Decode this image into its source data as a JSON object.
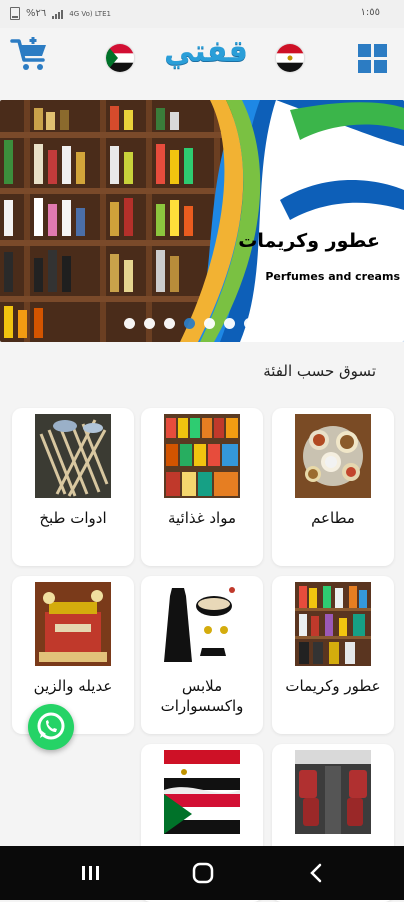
{
  "status_bar": {
    "time": "١:٥٥",
    "battery": "%٢٦",
    "network": "4G Vo) LTE1"
  },
  "header": {
    "logo_text": "قفتي",
    "cart_icon": "cart-icon",
    "menu_icon": "grid-menu-icon"
  },
  "banner": {
    "title": "عطور وكريمات",
    "subtitle": "Perfumes and creams",
    "slide_count": 8,
    "active_slide": 5
  },
  "section": {
    "title": "تسوق حسب الفئة"
  },
  "categories": [
    {
      "label": "مطاعم"
    },
    {
      "label": "مواد غذائية"
    },
    {
      "label": "ادوات طبخ"
    },
    {
      "label": "عطور وكريمات"
    },
    {
      "label": "ملابس واكسسوارات"
    },
    {
      "label": "عديله والزين"
    },
    {
      "label": ""
    },
    {
      "label": ""
    }
  ],
  "colors": {
    "accent": "#2c7cc3",
    "logo": "#2a9ed8",
    "whatsapp": "#25d366"
  }
}
